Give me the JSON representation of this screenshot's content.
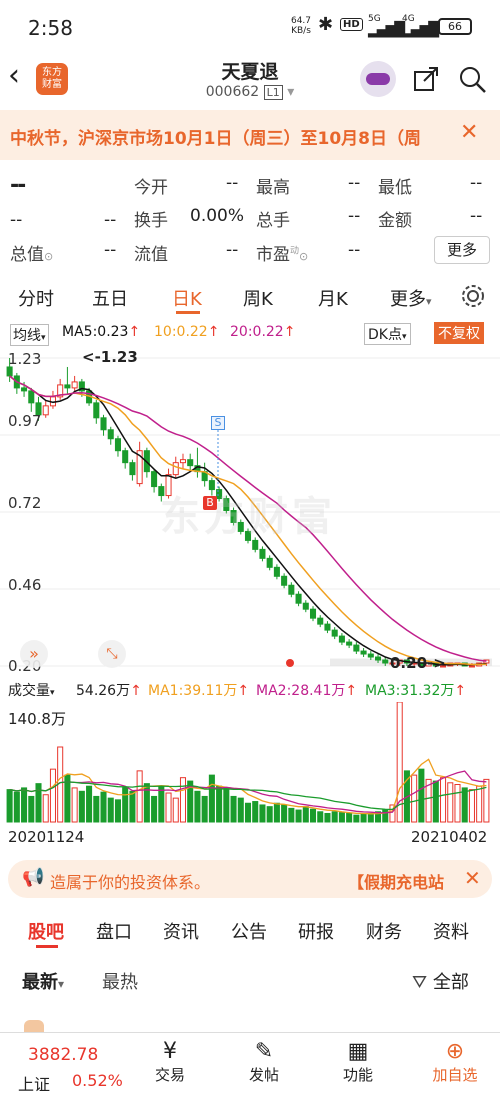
{
  "status": {
    "time": "2:58",
    "speed_top": "64.7",
    "speed_unit": "KB/s",
    "hd": "HD",
    "net1": "5G",
    "net2": "4G",
    "battery": "66"
  },
  "header": {
    "app_logo_line1": "东方",
    "app_logo_line2": "财富",
    "stock_name": "天夏退",
    "stock_code": "000662",
    "level_badge": "L1"
  },
  "notice": {
    "text": "中秋节，沪深京市场10月1日（周三）至10月8日（周"
  },
  "quote": {
    "price": "--",
    "rows": [
      [
        {
          "label": "今开",
          "value": "--"
        },
        {
          "label": "最高",
          "value": "--"
        },
        {
          "label": "最低",
          "value": "--"
        }
      ],
      [
        {
          "label": "换手",
          "value": "0.00%"
        },
        {
          "label": "总手",
          "value": "--"
        },
        {
          "label": "金额",
          "value": "--"
        }
      ],
      [
        {
          "label": "流值",
          "value": "--"
        },
        {
          "label": "市盈",
          "value": "--"
        }
      ]
    ],
    "left_row2_a": "--",
    "left_row2_b": "--",
    "total_value_label": "总值",
    "total_value": "--",
    "pe_sup": "动",
    "more_button": "更多"
  },
  "tabs": {
    "items": [
      "分时",
      "五日",
      "日K",
      "周K",
      "月K",
      "更多"
    ],
    "active": 2
  },
  "ma_row": {
    "select": "均线",
    "ma5": "MA5:0.23",
    "ma10": "10:0.22",
    "ma20": "20:0.22",
    "dk": "DK点",
    "fq": "不复权"
  },
  "kchart": {
    "y_labels": [
      "1.23",
      "0.97",
      "0.72",
      "0.46",
      "0.20"
    ],
    "high_marker": "1.23",
    "low_marker": "0.20",
    "watermark": "东方财富",
    "buy_marker": "B",
    "sell_marker": "S"
  },
  "vol_row": {
    "select": "成交量",
    "vol": "54.26万",
    "ma1": "MA1:39.11万",
    "ma2": "MA2:28.41万",
    "ma3": "MA3:31.32万"
  },
  "volchart": {
    "max_label": "140.8万"
  },
  "dates": {
    "start": "20201124",
    "end": "20210402"
  },
  "promo": {
    "text": "造属于你的投资体系。",
    "link": "【假期充电站"
  },
  "subtabs": {
    "items": [
      "股吧",
      "盘口",
      "资讯",
      "公告",
      "研报",
      "财务",
      "资料"
    ],
    "active": 0
  },
  "sortbar": {
    "latest": "最新",
    "hot": "最热",
    "filter": "全部"
  },
  "bottom": {
    "index_value": "3882.78",
    "index_name": "上证",
    "index_change": "0.52%",
    "trade": "交易",
    "post": "发帖",
    "func": "功能",
    "add": "加自选"
  },
  "colors": {
    "accent": "#e8662c",
    "red": "#e8362c",
    "green": "#1a9c2c",
    "ma5": "#111111",
    "ma10": "#f0a020",
    "ma20": "#c0208c"
  },
  "chart_data": {
    "type": "candlestick",
    "ylim": [
      0.2,
      1.23
    ],
    "ma": {
      "MA5": 0.23,
      "MA10": 0.22,
      "MA20": 0.22
    },
    "candles": [
      [
        1.2,
        1.17,
        1.23,
        1.15
      ],
      [
        1.17,
        1.13,
        1.18,
        1.11
      ],
      [
        1.13,
        1.12,
        1.15,
        1.1
      ],
      [
        1.12,
        1.08,
        1.13,
        1.05
      ],
      [
        1.08,
        1.04,
        1.1,
        1.02
      ],
      [
        1.04,
        1.07,
        1.09,
        1.03
      ],
      [
        1.07,
        1.1,
        1.12,
        1.06
      ],
      [
        1.1,
        1.14,
        1.16,
        1.09
      ],
      [
        1.14,
        1.13,
        1.2,
        1.11
      ],
      [
        1.13,
        1.15,
        1.17,
        1.12
      ],
      [
        1.15,
        1.12,
        1.16,
        1.1
      ],
      [
        1.12,
        1.08,
        1.13,
        1.07
      ],
      [
        1.08,
        1.03,
        1.09,
        1.01
      ],
      [
        1.03,
        0.99,
        1.04,
        0.97
      ],
      [
        0.99,
        0.96,
        1.0,
        0.94
      ],
      [
        0.96,
        0.92,
        0.97,
        0.9
      ],
      [
        0.92,
        0.88,
        0.93,
        0.86
      ],
      [
        0.88,
        0.84,
        0.89,
        0.82
      ],
      [
        0.81,
        0.92,
        0.95,
        0.8
      ],
      [
        0.92,
        0.85,
        0.93,
        0.83
      ],
      [
        0.85,
        0.8,
        0.86,
        0.78
      ],
      [
        0.8,
        0.77,
        0.81,
        0.75
      ],
      [
        0.77,
        0.84,
        0.86,
        0.76
      ],
      [
        0.84,
        0.88,
        0.9,
        0.83
      ],
      [
        0.88,
        0.89,
        0.91,
        0.86
      ],
      [
        0.89,
        0.87,
        0.91,
        0.85
      ],
      [
        0.87,
        0.85,
        0.93,
        0.83
      ],
      [
        0.85,
        0.82,
        0.88,
        0.8
      ],
      [
        0.82,
        0.79,
        0.83,
        0.77
      ],
      [
        0.79,
        0.76,
        0.8,
        0.75
      ],
      [
        0.76,
        0.72,
        0.77,
        0.71
      ],
      [
        0.72,
        0.68,
        0.73,
        0.67
      ],
      [
        0.68,
        0.65,
        0.69,
        0.64
      ],
      [
        0.65,
        0.62,
        0.66,
        0.61
      ],
      [
        0.62,
        0.59,
        0.63,
        0.58
      ],
      [
        0.59,
        0.56,
        0.6,
        0.55
      ],
      [
        0.56,
        0.53,
        0.57,
        0.52
      ],
      [
        0.53,
        0.5,
        0.54,
        0.49
      ],
      [
        0.5,
        0.47,
        0.51,
        0.46
      ],
      [
        0.47,
        0.44,
        0.48,
        0.43
      ],
      [
        0.44,
        0.41,
        0.45,
        0.4
      ],
      [
        0.41,
        0.39,
        0.42,
        0.38
      ],
      [
        0.39,
        0.36,
        0.4,
        0.35
      ],
      [
        0.36,
        0.34,
        0.37,
        0.33
      ],
      [
        0.34,
        0.32,
        0.35,
        0.31
      ],
      [
        0.32,
        0.3,
        0.33,
        0.29
      ],
      [
        0.3,
        0.28,
        0.31,
        0.27
      ],
      [
        0.28,
        0.27,
        0.29,
        0.26
      ],
      [
        0.27,
        0.25,
        0.28,
        0.24
      ],
      [
        0.25,
        0.24,
        0.26,
        0.23
      ],
      [
        0.24,
        0.23,
        0.25,
        0.22
      ],
      [
        0.23,
        0.22,
        0.24,
        0.21
      ],
      [
        0.22,
        0.21,
        0.23,
        0.2
      ],
      [
        0.21,
        0.21,
        0.22,
        0.2
      ],
      [
        0.21,
        0.22,
        0.22,
        0.2
      ],
      [
        0.22,
        0.21,
        0.22,
        0.2
      ],
      [
        0.21,
        0.21,
        0.22,
        0.2
      ],
      [
        0.21,
        0.2,
        0.21,
        0.2
      ],
      [
        0.2,
        0.21,
        0.21,
        0.2
      ],
      [
        0.21,
        0.2,
        0.21,
        0.2
      ],
      [
        0.2,
        0.2,
        0.21,
        0.2
      ],
      [
        0.2,
        0.21,
        0.21,
        0.2
      ],
      [
        0.21,
        0.21,
        0.21,
        0.2
      ],
      [
        0.21,
        0.2,
        0.21,
        0.2
      ],
      [
        0.2,
        0.2,
        0.21,
        0.2
      ],
      [
        0.2,
        0.21,
        0.21,
        0.2
      ],
      [
        0.21,
        0.22,
        0.22,
        0.2
      ]
    ],
    "volume_max": 140.8,
    "volume": [
      38,
      35,
      40,
      30,
      45,
      32,
      62,
      88,
      55,
      40,
      36,
      42,
      30,
      35,
      28,
      26,
      40,
      36,
      60,
      45,
      30,
      42,
      34,
      28,
      52,
      48,
      36,
      30,
      55,
      42,
      40,
      30,
      28,
      22,
      24,
      20,
      18,
      22,
      20,
      16,
      14,
      18,
      15,
      12,
      10,
      12,
      11,
      10,
      8,
      9,
      10,
      12,
      14,
      20,
      140.8,
      60,
      55,
      62,
      50,
      48,
      52,
      46,
      44,
      40,
      38,
      42,
      50
    ]
  }
}
